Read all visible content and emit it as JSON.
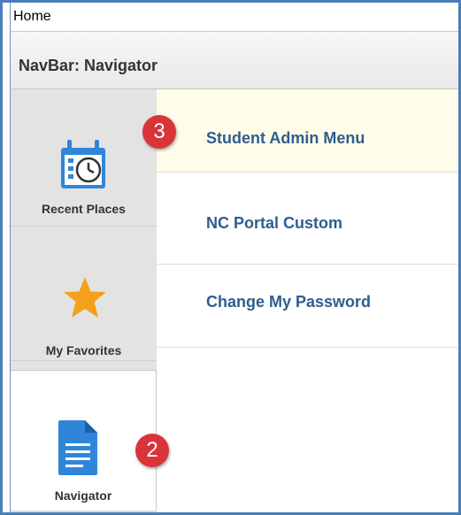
{
  "topbar": {
    "home_label": "Home"
  },
  "header": {
    "title": "NavBar: Navigator"
  },
  "sidebar": {
    "items": [
      {
        "label": "Recent Places",
        "icon": "calendar-clock-icon"
      },
      {
        "label": "My Favorites",
        "icon": "star-icon"
      },
      {
        "label": "Navigator",
        "icon": "document-icon"
      }
    ]
  },
  "menu": {
    "items": [
      {
        "label": "Student Admin Menu"
      },
      {
        "label": "NC Portal Custom"
      },
      {
        "label": "Change My Password"
      }
    ]
  },
  "callouts": {
    "first": "3",
    "second": "2"
  },
  "colors": {
    "frame_border": "#4a7ebb",
    "menu_link": "#2f5d8f",
    "highlight_row": "#fffce9",
    "callout_red": "#d9343a",
    "icon_blue": "#2f86d9",
    "star_orange": "#f5a019"
  }
}
